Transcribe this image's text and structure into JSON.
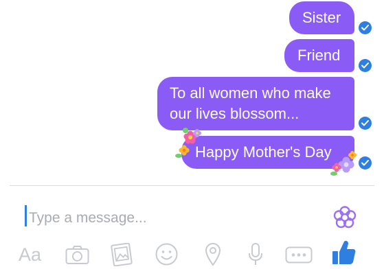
{
  "messages": [
    {
      "line1": "Sister",
      "status": "delivered"
    },
    {
      "line1": "Friend",
      "status": "delivered"
    },
    {
      "line1": "To all women who make",
      "line2": "our lives blossom...",
      "status": "delivered"
    },
    {
      "line1": "Happy Mother's Day",
      "status": "delivered",
      "decoration": "flower-sticker"
    }
  ],
  "composer": {
    "placeholder": "Type a message..."
  },
  "toolbar": {
    "text_label": "Aa",
    "icons": [
      "camera-icon",
      "gallery-icon",
      "emoji-icon",
      "location-icon",
      "microphone-icon",
      "more-icon",
      "thumbs-up-icon"
    ]
  },
  "colors": {
    "bubble": "#8a5cf5",
    "delivered_check": "#2f7fe0",
    "toolbar_icon": "#c7cacf",
    "like": "#2f7fe0",
    "flower_button": "#9b6ff3"
  }
}
